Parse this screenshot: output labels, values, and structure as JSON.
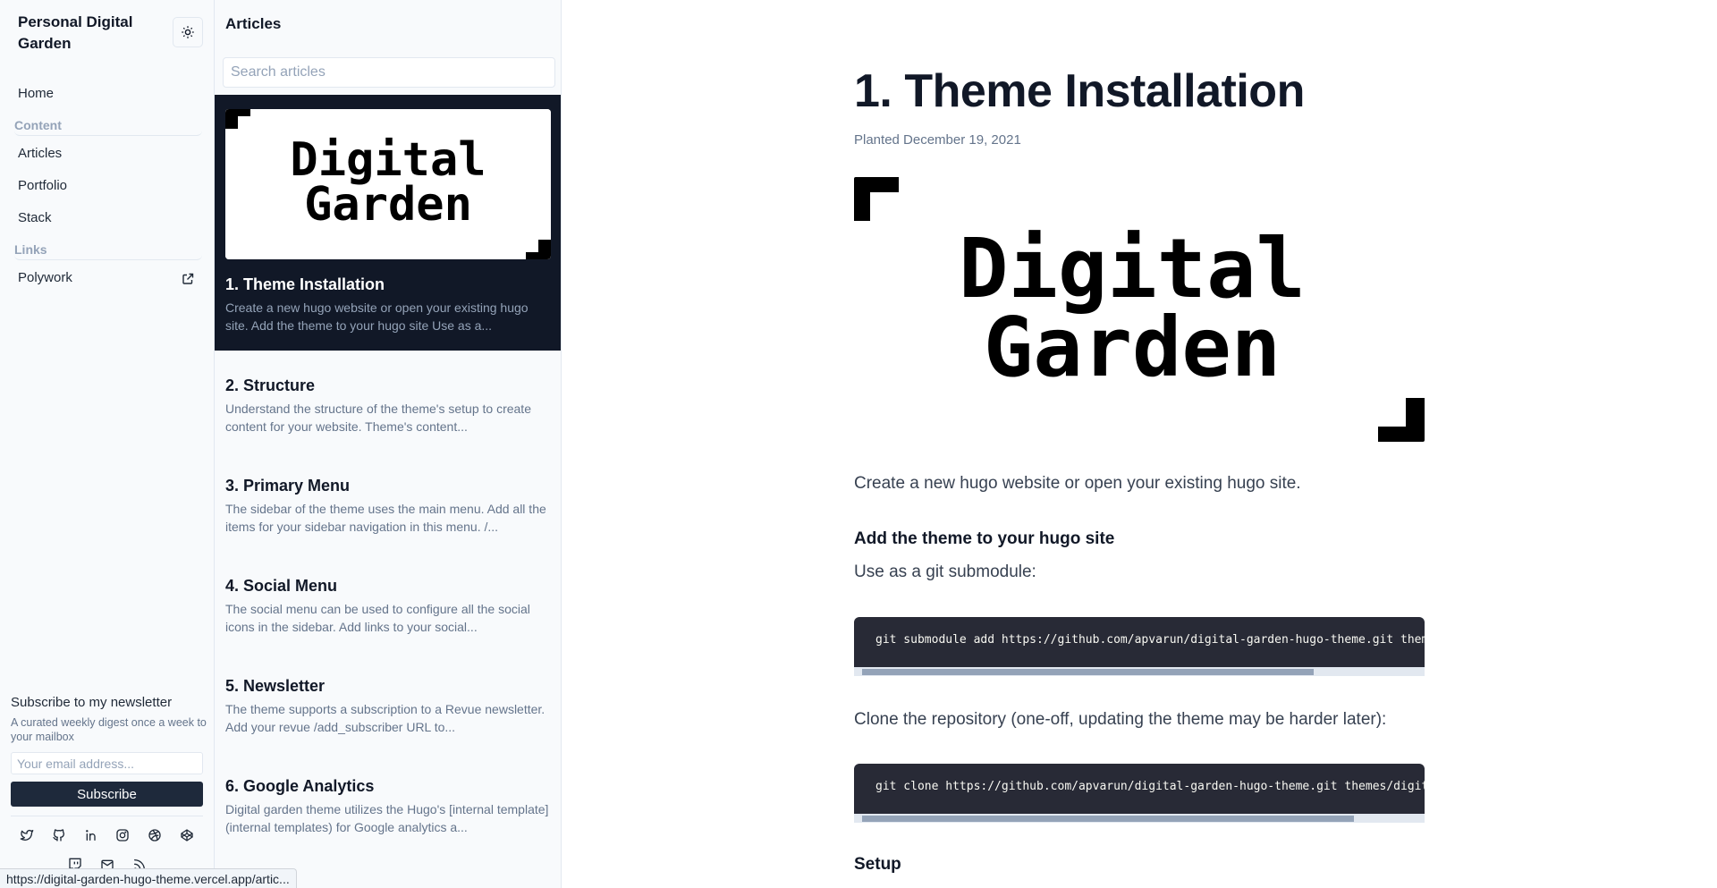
{
  "sidebar": {
    "site_title": "Personal Digital Garden",
    "theme_toggle_icon": "sun-icon",
    "nav": {
      "home": "Home",
      "content_section": "Content",
      "articles": "Articles",
      "portfolio": "Portfolio",
      "stack": "Stack",
      "links_section": "Links",
      "polywork": "Polywork"
    },
    "newsletter": {
      "title": "Subscribe to my newsletter",
      "description": "A curated weekly digest once a week to your mailbox",
      "email_placeholder": "Your email address...",
      "email_value": "",
      "subscribe_label": "Subscribe"
    },
    "social_icons": [
      "twitter-icon",
      "github-icon",
      "linkedin-icon",
      "instagram-icon",
      "dribbble-icon",
      "codepen-icon",
      "twitch-icon",
      "mail-icon",
      "rss-icon"
    ]
  },
  "articles_panel": {
    "title": "Articles",
    "search_placeholder": "Search articles",
    "search_value": "",
    "items": [
      {
        "title": "1. Theme Installation",
        "excerpt": "Create a new hugo website or open your existing hugo site. Add the theme to your hugo site Use as a...",
        "thumbnail_text": [
          "Digital",
          "Garden"
        ],
        "active": true
      },
      {
        "title": "2. Structure",
        "excerpt": "Understand the structure of the theme's setup to create content for your website. Theme's content..."
      },
      {
        "title": "3. Primary Menu",
        "excerpt": "The sidebar of the theme uses the main menu. Add all the items for your sidebar navigation in this menu. /..."
      },
      {
        "title": "4. Social Menu",
        "excerpt": "The social menu can be used to configure all the social icons in the sidebar. Add links to your social..."
      },
      {
        "title": "5. Newsletter",
        "excerpt": "The theme supports a subscription to a Revue newsletter. Add your revue /add_subscriber URL to..."
      },
      {
        "title": "6. Google Analytics",
        "excerpt": "Digital garden theme utilizes the Hugo's [internal template](internal templates) for Google analytics a..."
      }
    ]
  },
  "article": {
    "title": "1. Theme Installation",
    "planted": "Planted December 19, 2021",
    "hero_text": [
      "Digital",
      "Garden"
    ],
    "intro": "Create a new hugo website or open your existing hugo site.",
    "section1_heading": "Add the theme to your hugo site",
    "submodule_label": "Use as a git submodule:",
    "code1": "git submodule add https://github.com/apvarun/digital-garden-hugo-theme.git themes/digital-garden",
    "clone_label": "Clone the repository (one-off, updating the theme may be harder later):",
    "code2": "git clone https://github.com/apvarun/digital-garden-hugo-theme.git themes/digital-garden",
    "section2_heading": "Setup"
  },
  "status_bar": {
    "url": "https://digital-garden-hugo-theme.vercel.app/artic..."
  },
  "colors": {
    "sidebar_bg": "#f8fafc",
    "active_card_bg": "#111827",
    "button_bg": "#1e293b",
    "code_bg": "#282a36",
    "muted_text": "#64748b",
    "section_label": "#94a3b8"
  }
}
